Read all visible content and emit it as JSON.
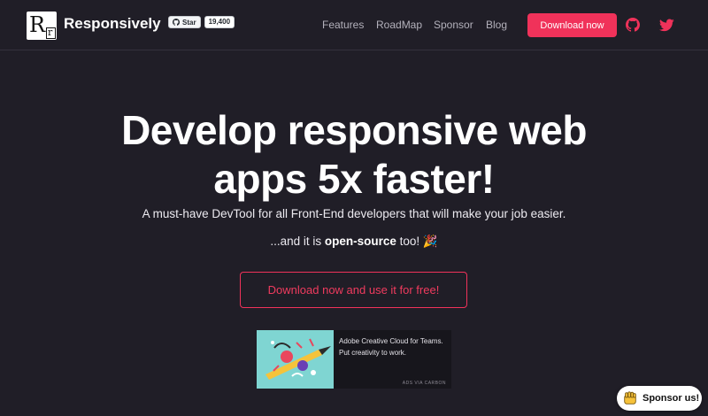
{
  "header": {
    "brand": "Responsively",
    "logo_letters": {
      "big": "R",
      "small": "r"
    },
    "github": {
      "star_label": "Star",
      "count": "19,400"
    },
    "nav": {
      "features": "Features",
      "roadmap": "RoadMap",
      "sponsor": "Sponsor",
      "blog": "Blog"
    },
    "download_label": "Download now",
    "icons": [
      "github-icon",
      "twitter-icon"
    ]
  },
  "hero": {
    "title_line1": "Develop responsive web",
    "title_line2": "apps 5x faster!",
    "subtitle": "A must-have DevTool for all Front-End developers that will make your job easier.",
    "open_source_prefix": "...and it is ",
    "open_source_bold": "open-source",
    "open_source_suffix": " too! 🎉",
    "cta_label": "Download now and use it for free!"
  },
  "ad": {
    "text": "Adobe Creative Cloud for Teams. Put creativity to work.",
    "via": "ADS VIA CARBON"
  },
  "sponsor_pill": {
    "label": "Sponsor us!"
  },
  "colors": {
    "background": "#201e27",
    "accent": "#f0325a",
    "nav_text": "#b3b1bb"
  }
}
